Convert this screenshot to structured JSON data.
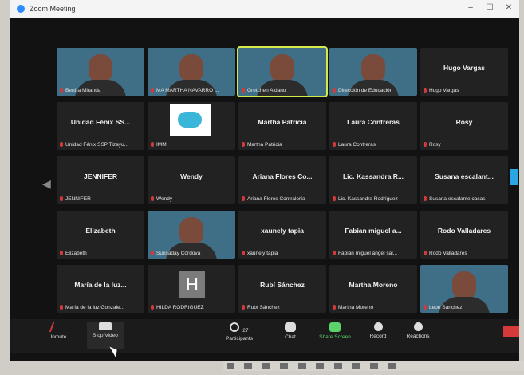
{
  "window": {
    "title": "Zoom Meeting"
  },
  "participants": [
    {
      "name": "Bertha Miranda",
      "display": "",
      "type": "video",
      "active": false
    },
    {
      "name": "MA MARTHA NAVARRO ...",
      "display": "",
      "type": "video",
      "active": false
    },
    {
      "name": "Gretchen Aldano",
      "display": "",
      "type": "video",
      "active": true
    },
    {
      "name": "Dirección de Educación",
      "display": "",
      "type": "video",
      "active": false
    },
    {
      "name": "Hugo Vargas",
      "display": "Hugo Vargas",
      "type": "name",
      "active": false
    },
    {
      "name": "Unidad Fénix SSP Tizayu...",
      "display": "Unidad Fénix SS...",
      "type": "name",
      "active": false
    },
    {
      "name": "IMM",
      "display": "",
      "type": "logo",
      "active": false
    },
    {
      "name": "Martha Patricia",
      "display": "Martha Patricia",
      "type": "name",
      "active": false
    },
    {
      "name": "Laura Contreras",
      "display": "Laura Contreras",
      "type": "name",
      "active": false
    },
    {
      "name": "Rosy",
      "display": "Rosy",
      "type": "name",
      "active": false
    },
    {
      "name": "JENNIFER",
      "display": "JENNIFER",
      "type": "name",
      "active": false
    },
    {
      "name": "Wendy",
      "display": "Wendy",
      "type": "name",
      "active": false
    },
    {
      "name": "Ariana Flores Contraloría",
      "display": "Ariana Flores Co...",
      "type": "name",
      "active": false
    },
    {
      "name": "Lic. Kassandra Rodríguez",
      "display": "Lic. Kassandra R...",
      "type": "name",
      "active": false
    },
    {
      "name": "Susana escalante casas",
      "display": "Susana escalant...",
      "type": "name",
      "active": false
    },
    {
      "name": "Elizabeth",
      "display": "Elizabeth",
      "type": "name",
      "active": false
    },
    {
      "name": "Sunsaday Córdova",
      "display": "",
      "type": "video",
      "active": false
    },
    {
      "name": "xaunely tapia",
      "display": "xaunely tapia",
      "type": "name",
      "active": false
    },
    {
      "name": "Fabian miguel angel sal...",
      "display": "Fabian miguel a...",
      "type": "name",
      "active": false
    },
    {
      "name": "Rodo Valladares",
      "display": "Rodo Valladares",
      "type": "name",
      "active": false
    },
    {
      "name": "María de la luz Gonzale...",
      "display": "María de la luz...",
      "type": "name",
      "active": false
    },
    {
      "name": "HILDA RODRIGUEZ",
      "display": "",
      "type": "initial",
      "initial": "H",
      "active": false
    },
    {
      "name": "Rubí Sánchez",
      "display": "Rubí Sánchez",
      "type": "name",
      "active": false
    },
    {
      "name": "Martha Moreno",
      "display": "Martha Moreno",
      "type": "name",
      "active": false
    },
    {
      "name": "Leon Sanchez",
      "display": "",
      "type": "video",
      "active": false
    }
  ],
  "toolbar": {
    "unmute": "Unmute",
    "stop_video": "Stop Video",
    "participants_count": "27",
    "participants": "Participants",
    "chat": "Chat",
    "share_screen": "Share Screen",
    "record": "Record",
    "reactions": "Reactions"
  },
  "colors": {
    "active_border": "#d6e94a",
    "share_green": "#5bd36a",
    "mute_red": "#d53a3a"
  }
}
